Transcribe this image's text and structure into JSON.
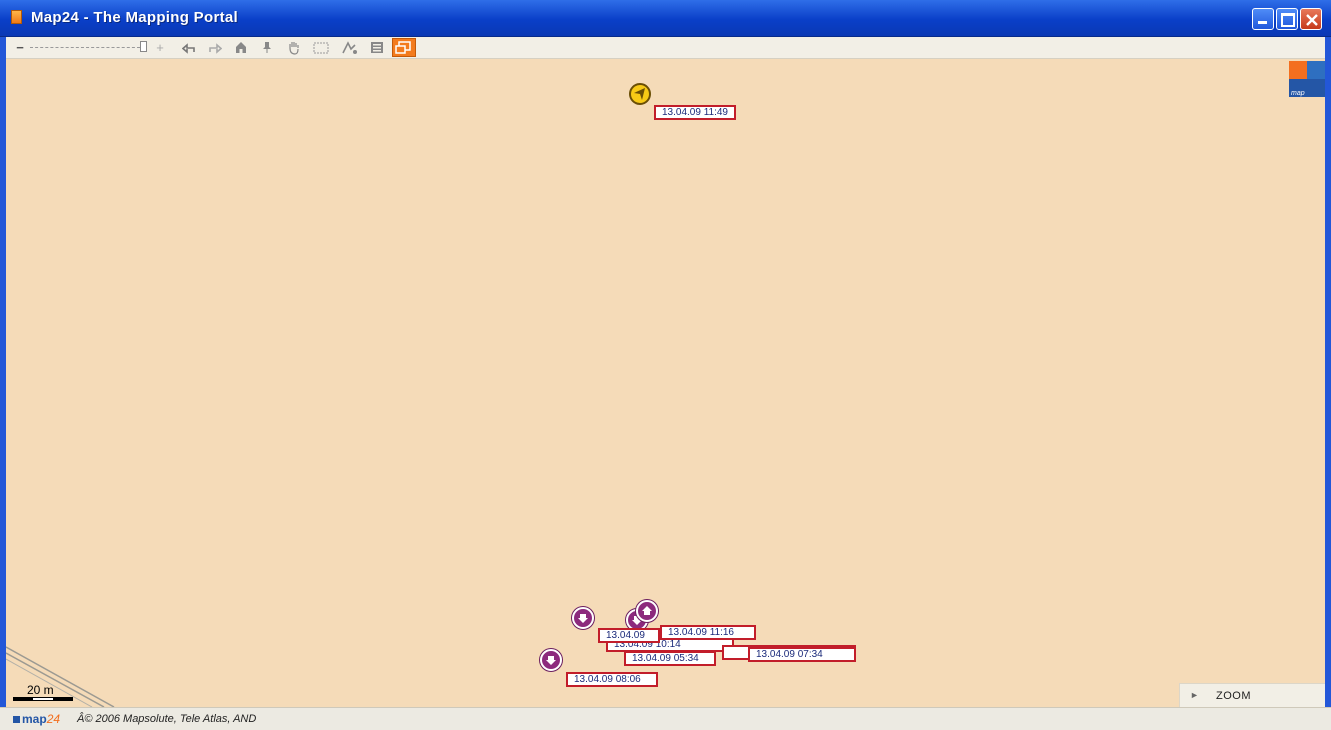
{
  "window": {
    "title": "Map24 - The Mapping Portal",
    "controls": [
      "minimize",
      "maximize",
      "close"
    ]
  },
  "toolbar": {
    "zoom_minus": "−",
    "zoom_plus": "+",
    "tools": [
      "back-arrow-icon",
      "forward-arrow-icon",
      "home-icon",
      "pin-icon",
      "hand-icon",
      "window-icon",
      "route-icon",
      "print-icon",
      "window-toggle-icon"
    ]
  },
  "map": {
    "logo_text": "map",
    "markers": {
      "top": {
        "label": "13.04.09  11:49",
        "color": "#f7c916"
      },
      "cluster": [
        {
          "label": "13.04.09  11:16"
        },
        {
          "label": "13.04.09"
        },
        {
          "label": "13.04.09  10:14"
        },
        {
          "label": "13.04.09  05:34"
        },
        {
          "label": "13.04.09  07:34"
        },
        {
          "label": "13.04.09  08:06"
        }
      ]
    },
    "scale": "20 m",
    "zoom_label": "ZOOM"
  },
  "footer": {
    "brand": "map",
    "brand_num": "24",
    "copyright": "Â© 2006 Mapsolute, Tele Atlas, AND"
  },
  "colors": {
    "map_bg": "#f5dbb8",
    "title_bar": "#0a3fc8",
    "label_border": "#c21d2a",
    "marker_purple": "#8c2a7d",
    "marker_yellow": "#f7c916",
    "active_tool": "#f37b1d"
  }
}
